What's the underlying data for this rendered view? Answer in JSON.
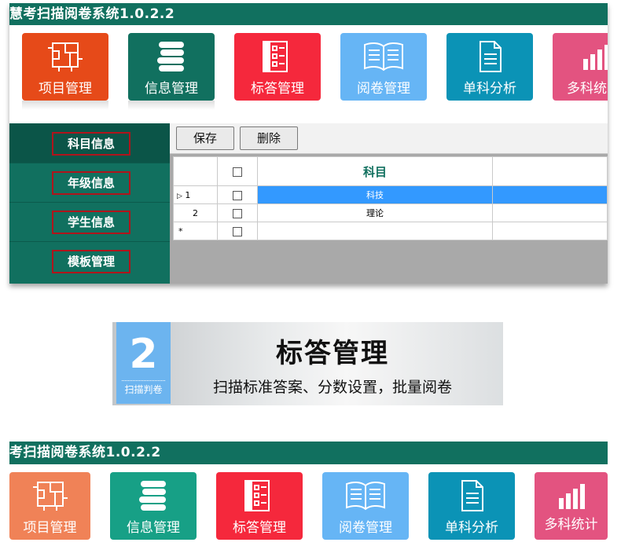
{
  "window1": {
    "title": "慧考扫描阅卷系统1.0.2.2",
    "ribbon": [
      {
        "label": "项目管理",
        "icon": "floorplan-icon",
        "color": "#e64a19"
      },
      {
        "label": "信息管理",
        "icon": "books-icon",
        "color": "#11705f"
      },
      {
        "label": "标答管理",
        "icon": "checklist-icon",
        "color": "#f5283c"
      },
      {
        "label": "阅卷管理",
        "icon": "open-book-icon",
        "color": "#66b5f5"
      },
      {
        "label": "单科分析",
        "icon": "document-icon",
        "color": "#0b93b6"
      },
      {
        "label": "多科统",
        "icon": "bar-chart-icon",
        "color": "#e35380"
      }
    ],
    "sidebar": [
      {
        "label": "科目信息"
      },
      {
        "label": "年级信息"
      },
      {
        "label": "学生信息"
      },
      {
        "label": "模板管理"
      }
    ],
    "toolbar": {
      "save": "保存",
      "delete": "删除"
    },
    "grid": {
      "column_subject": "科目",
      "rows": [
        {
          "no": "1",
          "subject": "科技",
          "selected": true
        },
        {
          "no": "2",
          "subject": "理论",
          "selected": false
        },
        {
          "no": "*",
          "subject": "",
          "selected": false
        }
      ]
    }
  },
  "banner": {
    "number": "2",
    "badge_caption": "扫描判卷",
    "title": "标答管理",
    "description": "扫描标准答案、分数设置，批量阅卷",
    "accent": "#6cb4ef"
  },
  "window2": {
    "title": "考扫描阅卷系统1.0.2.2",
    "ribbon": [
      {
        "label": "项目管理",
        "icon": "floorplan-icon",
        "color": "#f08257"
      },
      {
        "label": "信息管理",
        "icon": "books-icon",
        "color": "#17a086"
      },
      {
        "label": "标答管理",
        "icon": "checklist-icon",
        "color": "#f5283c"
      },
      {
        "label": "阅卷管理",
        "icon": "open-book-icon",
        "color": "#66b5f5"
      },
      {
        "label": "单科分析",
        "icon": "document-icon",
        "color": "#0b93b6"
      },
      {
        "label": "多科统计",
        "icon": "bar-chart-icon",
        "color": "#e35380"
      }
    ]
  }
}
